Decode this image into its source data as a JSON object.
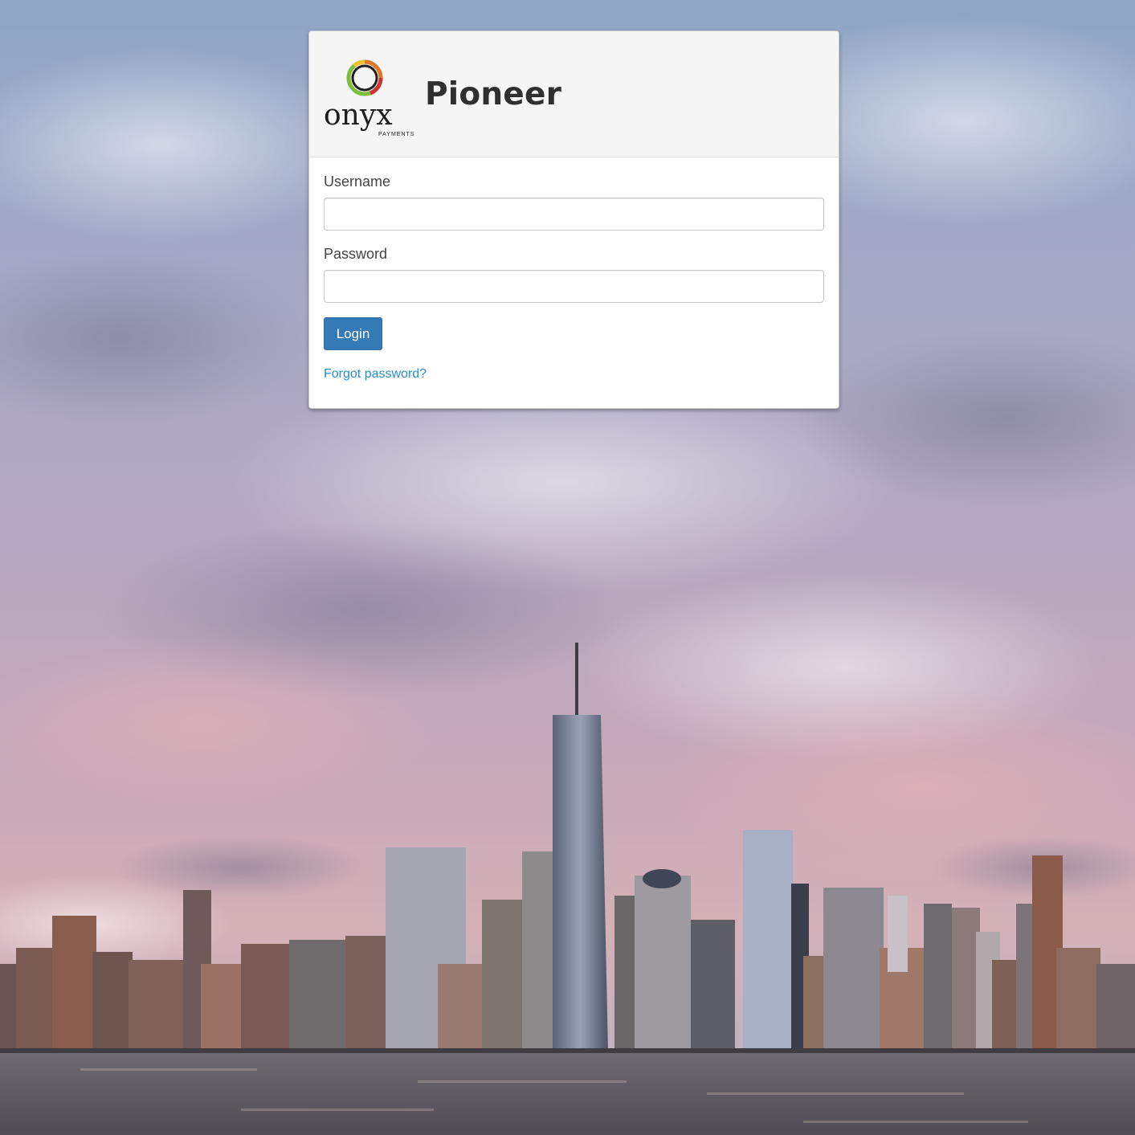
{
  "app": {
    "title": "Pioneer"
  },
  "brand": {
    "logo_text": "onyx",
    "logo_subtext": "PAYMENTS",
    "logo_icon": "onyx-ring-logo"
  },
  "form": {
    "username_label": "Username",
    "username_value": "",
    "username_placeholder": "",
    "password_label": "Password",
    "password_value": "",
    "password_placeholder": "",
    "login_label": "Login",
    "forgot_label": "Forgot password?"
  },
  "colors": {
    "primary_button": "#337ab7",
    "link": "#2a8fc9",
    "header_bg": "#f5f5f5"
  }
}
